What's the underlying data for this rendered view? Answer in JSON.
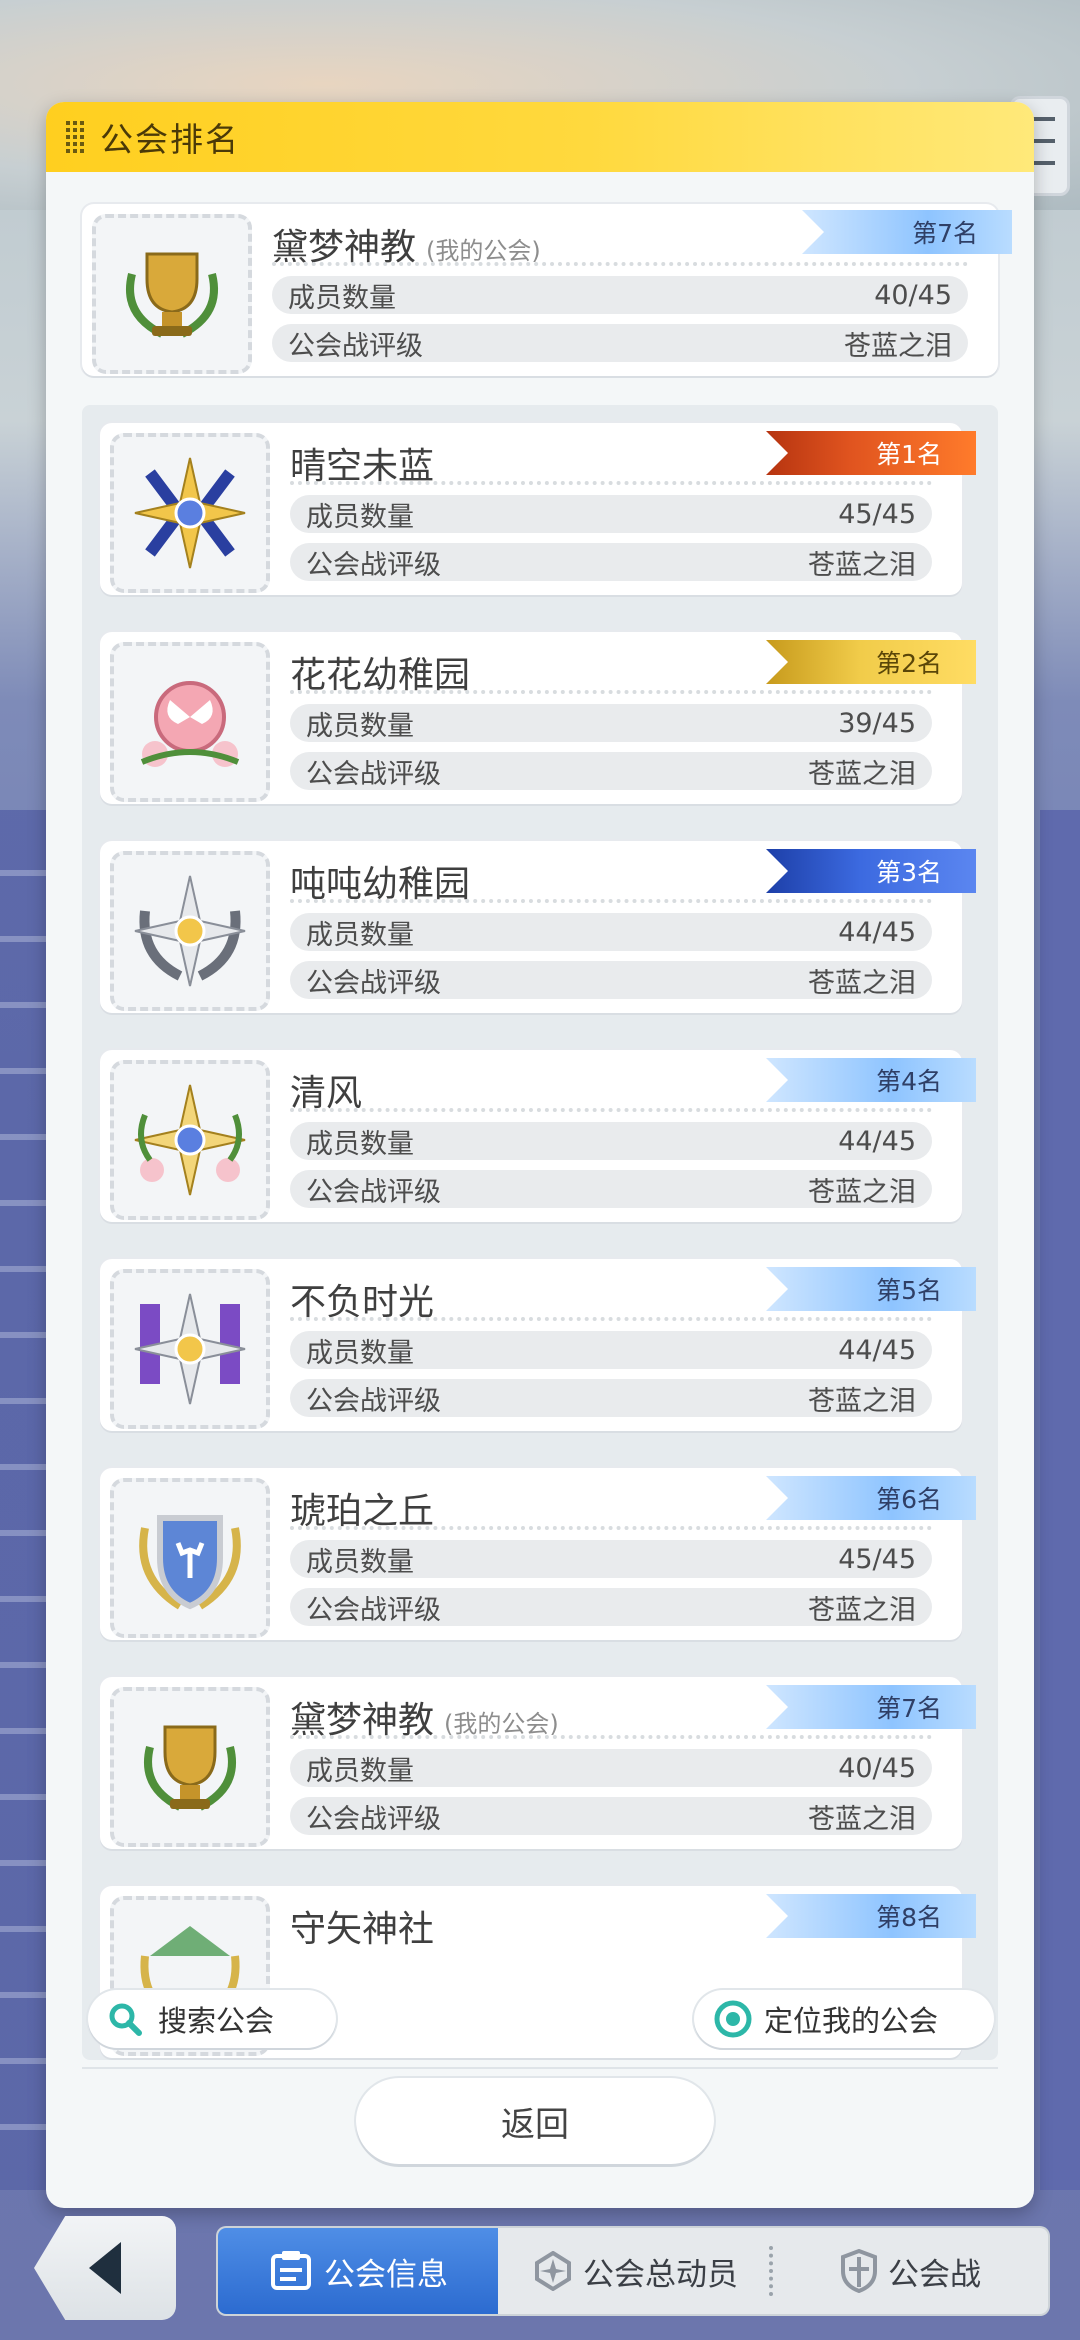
{
  "modal": {
    "title": "公会排名"
  },
  "my_guild": {
    "name": "黛梦神教",
    "note": "(我的公会)",
    "rank": "第7名",
    "members_label": "成员数量",
    "members": "40/45",
    "rating_label": "公会战评级",
    "rating": "苍蓝之泪"
  },
  "guilds": [
    {
      "name": "晴空未蓝",
      "note": "",
      "rank": "第1名",
      "members_label": "成员数量",
      "members": "45/45",
      "rating_label": "公会战评级",
      "rating": "苍蓝之泪"
    },
    {
      "name": "花花幼稚园",
      "note": "",
      "rank": "第2名",
      "members_label": "成员数量",
      "members": "39/45",
      "rating_label": "公会战评级",
      "rating": "苍蓝之泪"
    },
    {
      "name": "吨吨幼稚园",
      "note": "",
      "rank": "第3名",
      "members_label": "成员数量",
      "members": "44/45",
      "rating_label": "公会战评级",
      "rating": "苍蓝之泪"
    },
    {
      "name": "清风",
      "note": "",
      "rank": "第4名",
      "members_label": "成员数量",
      "members": "44/45",
      "rating_label": "公会战评级",
      "rating": "苍蓝之泪"
    },
    {
      "name": "不负时光",
      "note": "",
      "rank": "第5名",
      "members_label": "成员数量",
      "members": "44/45",
      "rating_label": "公会战评级",
      "rating": "苍蓝之泪"
    },
    {
      "name": "琥珀之丘",
      "note": "",
      "rank": "第6名",
      "members_label": "成员数量",
      "members": "45/45",
      "rating_label": "公会战评级",
      "rating": "苍蓝之泪"
    },
    {
      "name": "黛梦神教",
      "note": "(我的公会)",
      "rank": "第7名",
      "members_label": "成员数量",
      "members": "40/45",
      "rating_label": "公会战评级",
      "rating": "苍蓝之泪"
    },
    {
      "name": "守矢神社",
      "note": "",
      "rank": "第8名",
      "members_label": "",
      "members": "",
      "rating_label": "",
      "rating": ""
    }
  ],
  "actions": {
    "search_label": "搜索公会",
    "locate_label": "定位我的公会",
    "return_label": "返回"
  },
  "bottom_nav": {
    "tabs": [
      "公会信息",
      "公会总动员",
      "公会战"
    ]
  },
  "colors": {
    "header_yellow": "#ffcf1f",
    "rank1": "#e0541f",
    "rank2": "#f1cc4a",
    "rank3": "#3c6ae0",
    "rank_default": "#8ec4ff",
    "tab_active": "#2c6bd0"
  }
}
